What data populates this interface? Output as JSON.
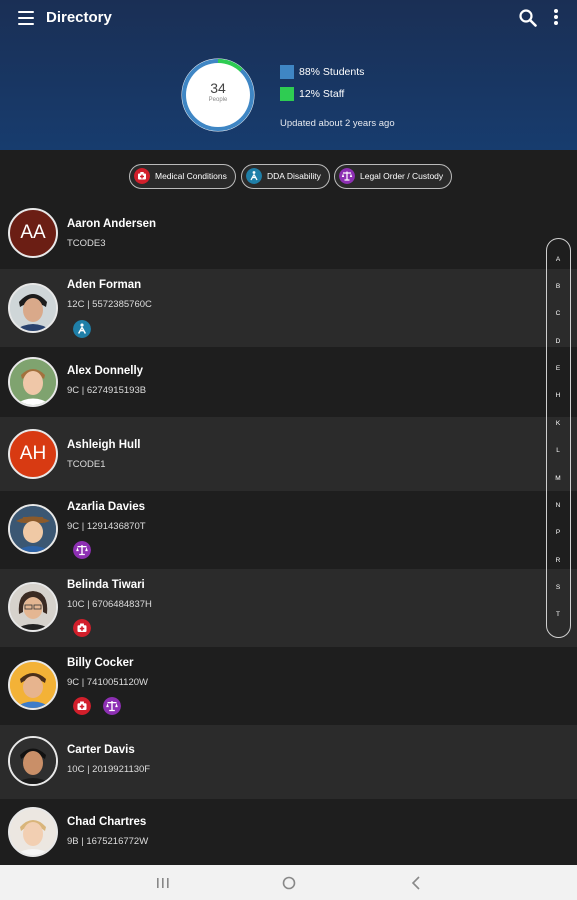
{
  "header": {
    "title": "Directory",
    "icons": {
      "menu": "hamburger-menu-icon",
      "search": "search-icon",
      "more": "more-vertical-icon"
    }
  },
  "summary": {
    "count": "34",
    "count_label": "People",
    "students_label": "88% Students",
    "staff_label": "12% Staff",
    "students_fraction": 0.88,
    "staff_fraction": 0.12,
    "updated": "Updated about 2 years ago",
    "colors": {
      "students": "#3f86c4",
      "staff": "#2ecc52"
    }
  },
  "filters": [
    {
      "label": "Medical Conditions",
      "icon": "medical-icon",
      "color": "#d21f2b"
    },
    {
      "label": "DDA Disability",
      "icon": "disability-icon",
      "color": "#1f7fa8"
    },
    {
      "label": "Legal Order / Custody",
      "icon": "legal-icon",
      "color": "#8d2fb3"
    }
  ],
  "people": [
    {
      "initials": "AA",
      "avatar_color": "#6b1e14",
      "name": "Aaron Andersen",
      "detail": "TCODE3",
      "badges": []
    },
    {
      "name": "Aden Forman",
      "detail": "12C | 5572385760C",
      "badges": [
        "disability"
      ]
    },
    {
      "name": "Alex Donnelly",
      "detail": "9C | 6274915193B",
      "badges": []
    },
    {
      "initials": "AH",
      "avatar_color": "#d83a12",
      "name": "Ashleigh Hull",
      "detail": "TCODE1",
      "badges": []
    },
    {
      "name": "Azarlia Davies",
      "detail": "9C | 1291436870T",
      "badges": [
        "legal"
      ]
    },
    {
      "name": "Belinda Tiwari",
      "detail": "10C | 6706484837H",
      "badges": [
        "medical"
      ]
    },
    {
      "name": "Billy Cocker",
      "detail": "9C | 7410051120W",
      "badges": [
        "medical",
        "legal"
      ]
    },
    {
      "name": "Carter Davis",
      "detail": "10C | 2019921130F",
      "badges": []
    },
    {
      "name": "Chad Chartres",
      "detail": "9B | 1675216772W",
      "badges": []
    }
  ],
  "alphabet_index": [
    "A",
    "B",
    "C",
    "D",
    "E",
    "H",
    "K",
    "L",
    "M",
    "N",
    "P",
    "R",
    "S",
    "T"
  ]
}
